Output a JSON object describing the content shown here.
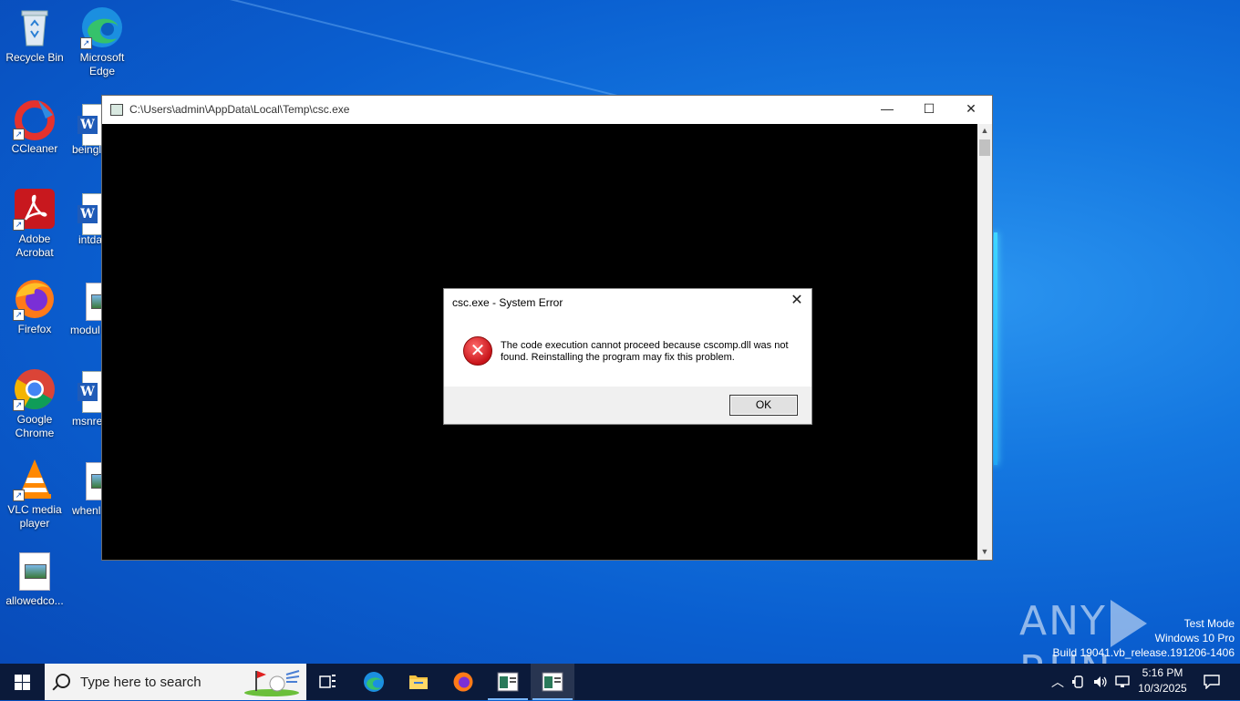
{
  "desktop": {
    "icons": [
      {
        "label": "Recycle Bin"
      },
      {
        "label": "Microsoft Edge"
      },
      {
        "label": "CCleaner"
      },
      {
        "label": "Adobe Acrobat"
      },
      {
        "label": "Firefox"
      },
      {
        "label": "Google Chrome"
      },
      {
        "label": "VLC media player"
      },
      {
        "label": "allowedco..."
      }
    ],
    "truncated_icons": [
      "beingl",
      "intda",
      "modul",
      "msnre",
      "whenl"
    ]
  },
  "console_window": {
    "title": "C:\\Users\\admin\\AppData\\Local\\Temp\\csc.exe",
    "minimize_glyph": "—",
    "maximize_glyph": "☐",
    "close_glyph": "✕"
  },
  "error_dialog": {
    "title": "csc.exe - System Error",
    "message": "The code execution cannot proceed because cscomp.dll was not found. Reinstalling the program may fix this problem.",
    "ok_label": "OK",
    "close_glyph": "✕"
  },
  "watermark": {
    "brand": "ANY RUN",
    "line1": "Test Mode",
    "line2": "Windows 10 Pro",
    "line3": "Build 19041.vb_release.191206-1406"
  },
  "taskbar": {
    "search_placeholder": "Type here to search",
    "clock_time": "5:16 PM",
    "clock_date": "10/3/2025"
  }
}
